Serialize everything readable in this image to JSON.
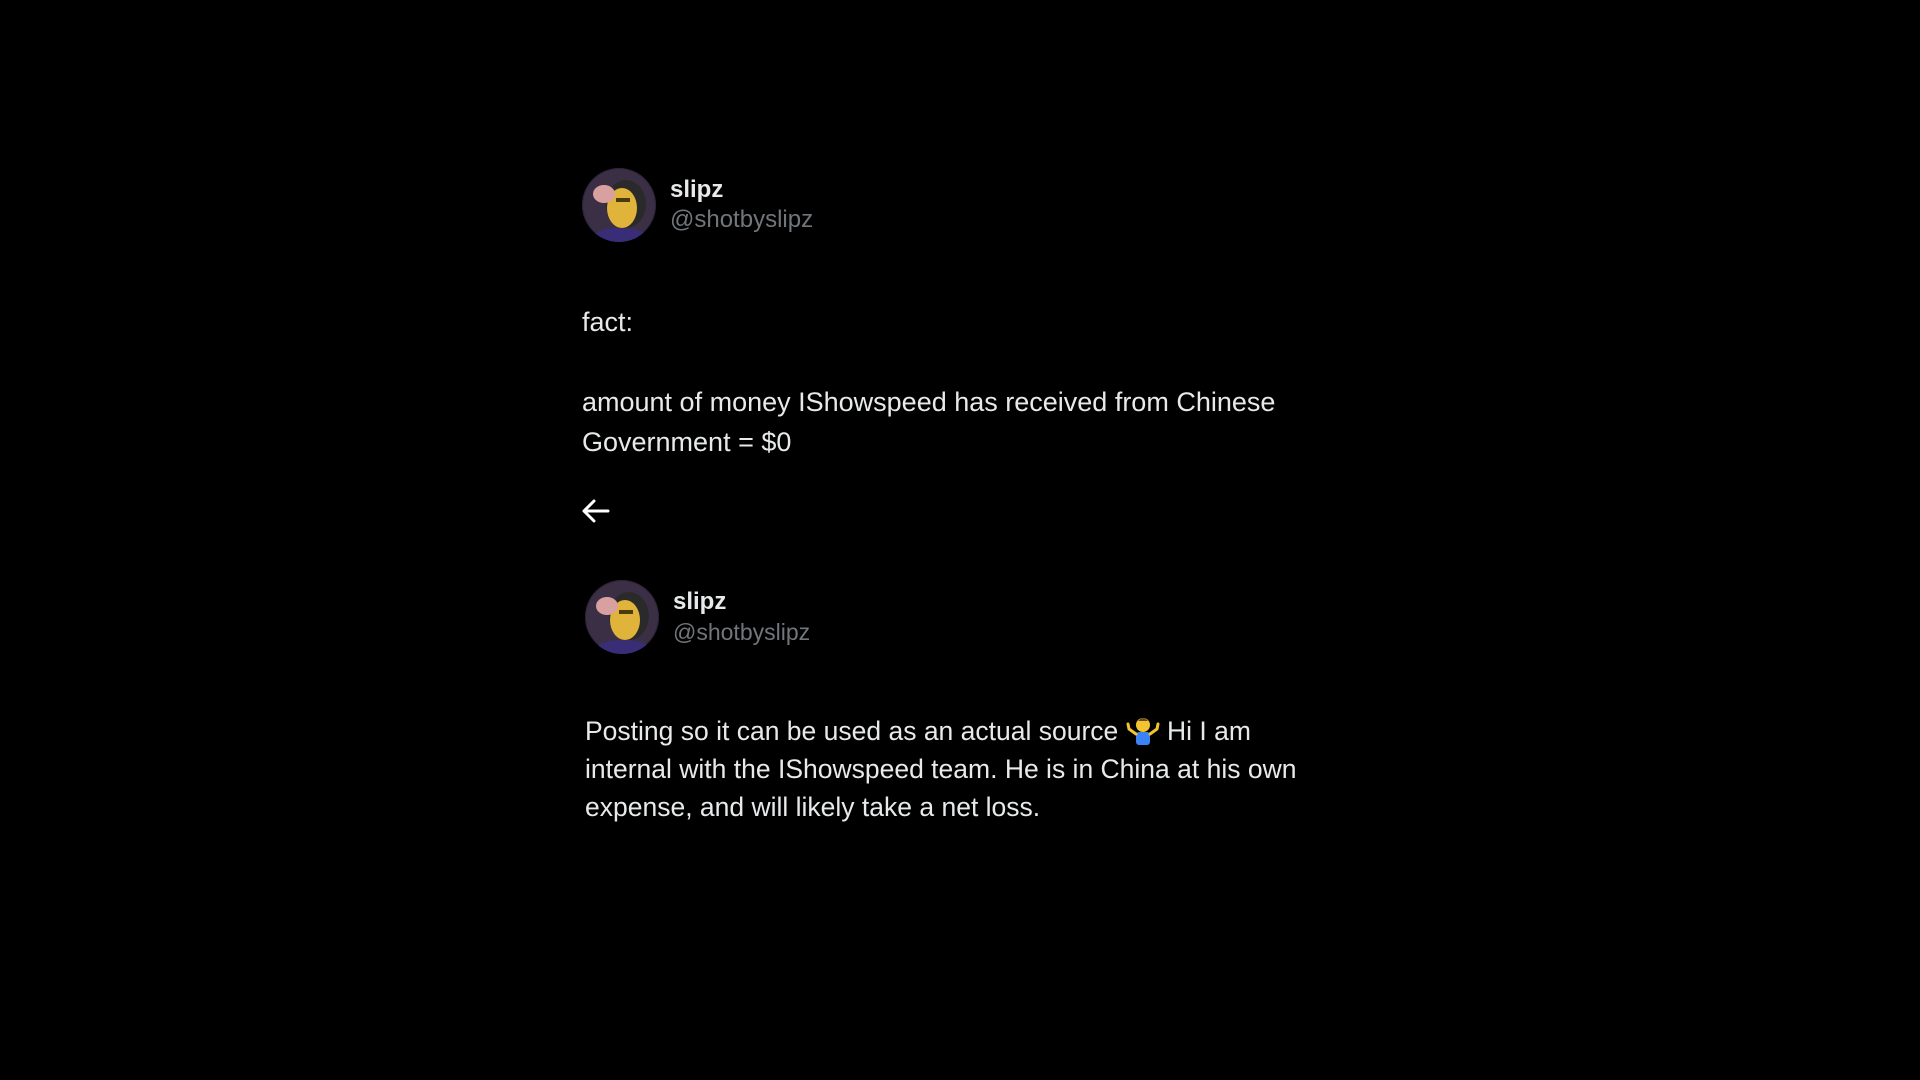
{
  "posts": [
    {
      "display_name": "slipz",
      "handle": "@shotbyslipz",
      "avatar_icon": "user-avatar-icon",
      "text_line_1": "fact:",
      "text_line_2": "amount of money IShowspeed has received from Chinese\nGovernment = $0"
    },
    {
      "display_name": "slipz",
      "handle": "@shotbyslipz",
      "avatar_icon": "user-avatar-icon",
      "text_before_emoji": "Posting so it can be used as an actual source ",
      "emoji_icon": "person-shrugging-emoji",
      "text_after_emoji": " Hi I am internal with the IShowspeed team. He is in China at his own expense, and will likely take a net loss."
    }
  ],
  "navigation": {
    "back_icon": "arrow-left-icon"
  },
  "colors": {
    "background": "#000000",
    "primary_text": "#e7e9ea",
    "secondary_text": "#71767b"
  }
}
